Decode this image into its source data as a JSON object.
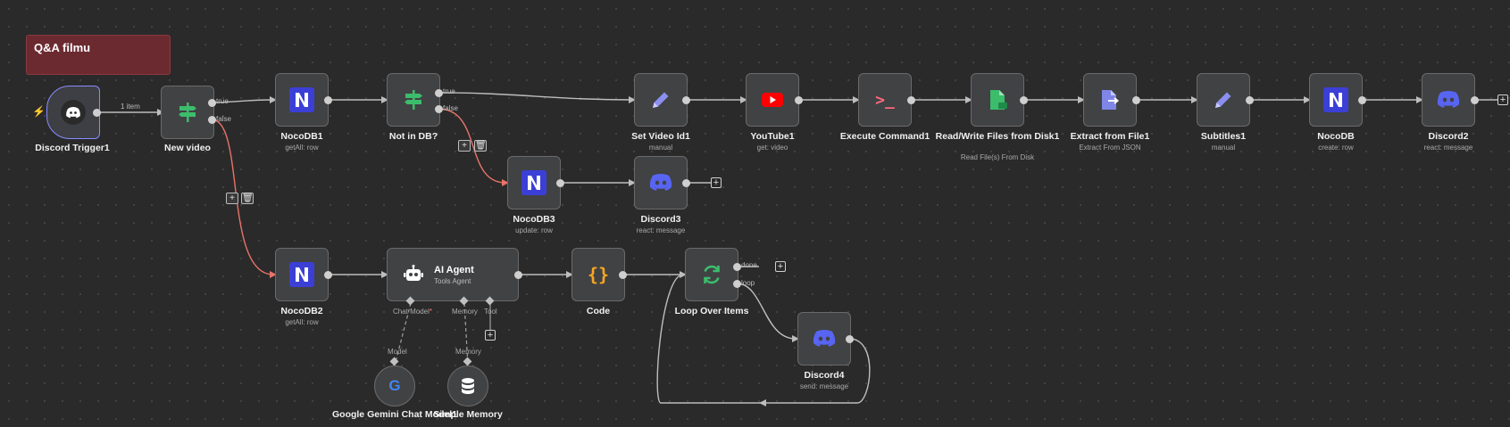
{
  "sticky": {
    "title": "Q&A filmu"
  },
  "nodes": {
    "discord_trigger": {
      "label": "Discord Trigger1"
    },
    "new_video": {
      "label": "New video"
    },
    "nocodb1": {
      "label": "NocoDB1",
      "sub": "getAll: row"
    },
    "not_in_db": {
      "label": "Not in DB?"
    },
    "set_video_id": {
      "label": "Set Video Id1",
      "sub": "manual"
    },
    "youtube1": {
      "label": "YouTube1",
      "sub": "get: video"
    },
    "execute_command": {
      "label": "Execute Command1"
    },
    "read_write_files": {
      "label": "Read/Write Files from Disk1",
      "sub": "Read File(s) From Disk"
    },
    "extract_from_file": {
      "label": "Extract from File1",
      "sub": "Extract From JSON"
    },
    "subtitles1": {
      "label": "Subtitles1",
      "sub": "manual"
    },
    "nocodb": {
      "label": "NocoDB",
      "sub": "create: row"
    },
    "discord2": {
      "label": "Discord2",
      "sub": "react: message"
    },
    "nocodb3": {
      "label": "NocoDB3",
      "sub": "update: row"
    },
    "discord3": {
      "label": "Discord3",
      "sub": "react: message"
    },
    "nocodb2": {
      "label": "NocoDB2",
      "sub": "getAll: row"
    },
    "ai_agent": {
      "label": "AI Agent",
      "sub": "Tools Agent"
    },
    "code": {
      "label": "Code"
    },
    "loop_over_items": {
      "label": "Loop Over Items"
    },
    "discord4": {
      "label": "Discord4",
      "sub": "send: message"
    },
    "gemini": {
      "label": "Google Gemini Chat Model1"
    },
    "simple_memory": {
      "label": "Simple Memory"
    }
  },
  "connection_labels": {
    "items": "1 item",
    "true1": "true",
    "false1": "false",
    "true2": "true",
    "false2": "false",
    "done": "done",
    "loop": "loop"
  },
  "agent_ports": {
    "chat_model": "Chat Model",
    "required_mark": "*",
    "memory": "Memory",
    "tool": "Tool",
    "model_in": "Model",
    "memory_in": "Memory"
  },
  "icons": {
    "plus": "+",
    "trash": "🗑",
    "code_braces": "{}",
    "terminal": ">_",
    "bolt": "⚡"
  },
  "colors": {
    "canvas": "#2a2a2a",
    "node": "#414244",
    "wire": "#bdbdbd",
    "wire_active": "#e8736a",
    "sticky": "#6b2a30",
    "nocodb": "#3b3fd6",
    "discord": "#5865f2",
    "youtube": "#ff0000",
    "green": "#3bbd6b"
  }
}
